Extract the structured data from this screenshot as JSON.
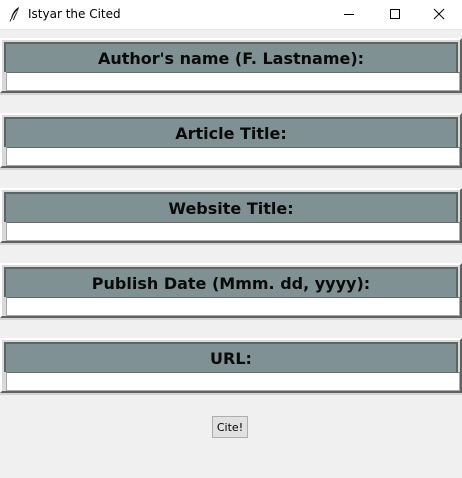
{
  "window": {
    "title": "Istyar the Cited",
    "app_icon": "feather-icon",
    "controls": [
      "minimize-icon",
      "maximize-icon",
      "close-icon"
    ]
  },
  "form": {
    "fields": [
      {
        "label": "Author's name (F. Lastname):",
        "value": ""
      },
      {
        "label": "Article Title:",
        "value": ""
      },
      {
        "label": "Website Title:",
        "value": ""
      },
      {
        "label": "Publish Date (Mmm. dd, yyyy):",
        "value": ""
      },
      {
        "label": "URL:",
        "value": ""
      }
    ],
    "submit_label": "Cite!"
  },
  "colors": {
    "label_bar": "#7f9192",
    "window_bg": "#f0f0f0"
  }
}
